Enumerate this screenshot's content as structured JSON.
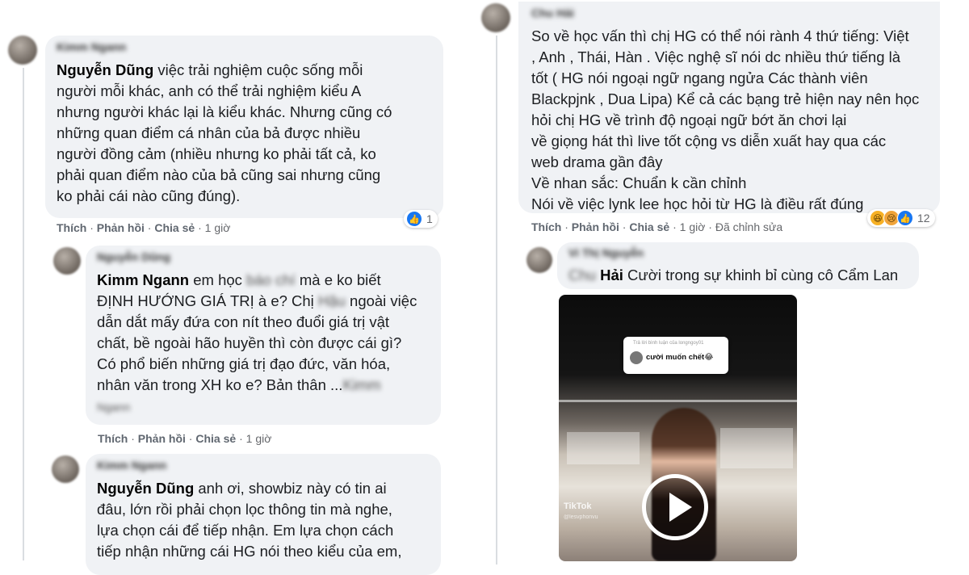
{
  "left": {
    "c1": {
      "name": "Kimm Ngann",
      "tag": "Nguyễn Dũng",
      "lines": [
        " việc trải nghiệm cuộc sống mỗi",
        "người mỗi khác, anh có thể trải nghiệm kiểu A",
        "nhưng người khác lại là kiểu khác. Nhưng cũng có",
        "những quan điểm cá nhân của bả được nhiều",
        "người đồng cảm (nhiều nhưng ko phải tất cả, ko",
        "phải quan điểm nào của bả cũng sai nhưng cũng",
        "ko phải cái nào cũng đúng)."
      ],
      "actions": {
        "like": "Thích",
        "reply": "Phản hồi",
        "share": "Chia sẻ",
        "time": "1 giờ"
      },
      "reaction_count": "1"
    },
    "c2": {
      "name": "Nguyễn Dũng",
      "tag": "Kimm Ngann",
      "line1_a": " em học ",
      "line1_blur": "báo chí",
      "line1_b": " mà e ko biết",
      "line2_a": "ĐỊNH HƯỚNG GIÁ TRỊ à e? Chị ",
      "line2_blur": "Hậu",
      "line2_b": " ngoài việc",
      "lines": [
        "dẫn dắt mấy đứa con nít theo đuổi giá trị vật",
        "chất, bề ngoài hão huyền thì còn được cái gì?",
        "Có phổ biến những giá trị đạo đức, văn hóa,"
      ],
      "last_a": "nhân văn trong XH ko e? Bản thân ",
      "last_dots": "...",
      "last_blur": "Kimm",
      "last_line_blur": "Ngann",
      "actions": {
        "like": "Thích",
        "reply": "Phản hồi",
        "share": "Chia sẻ",
        "time": "1 giờ"
      }
    },
    "c3": {
      "name": "Kimm Ngann",
      "tag": "Nguyễn Dũng",
      "lines": [
        " anh ơi, showbiz này có tin ai",
        "đâu, lớn rồi phải chọn lọc thông tin mà nghe,",
        "lựa chọn cái để tiếp nhận. Em lựa chọn cách",
        "tiếp nhận những cái HG nói theo kiểu của em,"
      ]
    }
  },
  "right": {
    "c1": {
      "name": "Chu Hải",
      "lines": [
        "So về học vấn thì chị HG có thể nói rành 4 thứ tiếng: Việt",
        ", Anh , Thái, Hàn . Việc nghệ sĩ nói dc nhiều thứ tiếng là",
        "tốt ( HG nói ngoại ngữ ngang ngửa Các thành viên",
        "Blackpjnk , Dua Lipa) Kể cả các bạng trẻ hiện nay nên học",
        "hỏi chị HG về trình độ ngoại ngữ bớt ăn chơi lại",
        "về giọng hát thì live tốt cộng vs diễn xuất hay qua các",
        "web drama gần đây",
        "Về nhan sắc: Chuẩn k cần chỉnh",
        "Nói về việc lynk lee học hỏi từ HG là điều rất đúng"
      ],
      "actions": {
        "like": "Thích",
        "reply": "Phản hồi",
        "share": "Chia sẻ",
        "time": "1 giờ",
        "edited": "Đã chỉnh sửa"
      },
      "reaction_count": "12"
    },
    "c2": {
      "name": "Vi Thị Nguyễn",
      "tag_blur": "Chu",
      "tag": "Hải",
      "text": " Cười trong sự khinh bỉ cùng cô Cẩm Lan",
      "video": {
        "reply_to": "Trả lời bình luận của longngoy01",
        "caption": "cười muốn chết😂",
        "watermark": "TikTok",
        "handle": "@lesvphonvu"
      }
    }
  }
}
